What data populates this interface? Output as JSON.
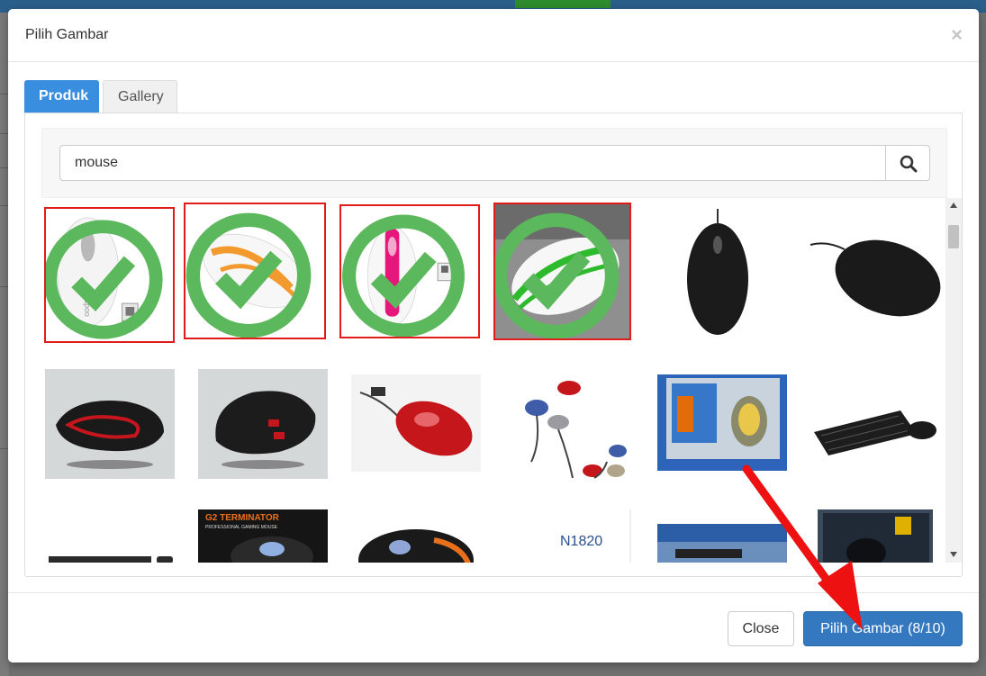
{
  "modal": {
    "title": "Pilih Gambar",
    "close_symbol": "×"
  },
  "tabs": [
    {
      "label": "Produk",
      "active": true
    },
    {
      "label": "Gallery",
      "active": false
    }
  ],
  "search": {
    "value": "mouse",
    "icon": "search-icon"
  },
  "images": [
    {
      "name": "white-rapoo-mouse",
      "selected": true
    },
    {
      "name": "white-orange-mouse",
      "selected": true
    },
    {
      "name": "white-pink-rapoo-mouse",
      "selected": true
    },
    {
      "name": "white-green-rapoo-mouse",
      "selected": true
    },
    {
      "name": "black-logitech-mouse-top",
      "selected": false
    },
    {
      "name": "black-logitech-mouse-side",
      "selected": false
    },
    {
      "name": "black-red-gaming-mouse",
      "selected": false
    },
    {
      "name": "black-red-gaming-mouse-2",
      "selected": false
    },
    {
      "name": "red-retractable-mouse",
      "selected": false
    },
    {
      "name": "retractable-mini-mice",
      "selected": false
    },
    {
      "name": "packaged-mouse",
      "selected": false
    },
    {
      "name": "keyboard-mouse-combo",
      "selected": false
    },
    {
      "name": "black-keyboard",
      "selected": false
    },
    {
      "name": "g2-terminator-gaming-mouse",
      "selected": false
    },
    {
      "name": "black-orange-gaming-mouse",
      "selected": false
    },
    {
      "name": "n1820-mouse",
      "selected": false
    },
    {
      "name": "keyboard-box",
      "selected": false
    },
    {
      "name": "boxed-mouse",
      "selected": false
    }
  ],
  "image_text": {
    "g2_label": "G2 TERMINATOR",
    "g2_sub": "PROFESSIONAL GAMING MOUSE",
    "n1820_label": "N1820",
    "rapoo": "rapoo"
  },
  "footer": {
    "close_label": "Close",
    "primary_label": "Pilih Gambar (8/10)"
  },
  "colors": {
    "accent": "#3478c0",
    "tab_active": "#3a8ee0",
    "selected_border": "#e21b1b",
    "check": "#5cb85c",
    "annotation_arrow": "#ee1111"
  }
}
